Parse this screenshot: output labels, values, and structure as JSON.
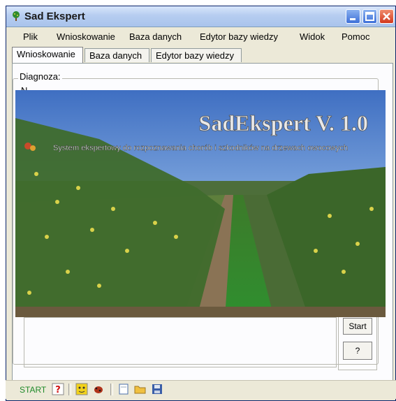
{
  "window": {
    "title": "Sad Ekspert"
  },
  "menubar": {
    "items": [
      "Plik",
      "Wnioskowanie",
      "Baza danych",
      "Edytor bazy wiedzy",
      "Widok",
      "Pomoc"
    ]
  },
  "tabs": [
    {
      "label": "Wnioskowanie",
      "active": true
    },
    {
      "label": "Baza danych",
      "active": false
    },
    {
      "label": "Edytor bazy wiedzy",
      "active": false
    }
  ],
  "diagnosis": {
    "label": "Diagnoza:",
    "second_line": "N"
  },
  "splash": {
    "title": "SadEkspert V. 1.0",
    "subtitle": "System ekspertowy do rozpoznawania chorób i szkodników na drzewach owocowych"
  },
  "buttons": {
    "start": "Start",
    "help": "?"
  },
  "statusbar": {
    "start_label": "START"
  },
  "icons": {
    "app": "tree-icon",
    "help": "question-icon",
    "disease": "face-icon",
    "pest": "bug-icon",
    "new": "new-document-icon",
    "open": "open-folder-icon",
    "save": "save-disk-icon"
  }
}
